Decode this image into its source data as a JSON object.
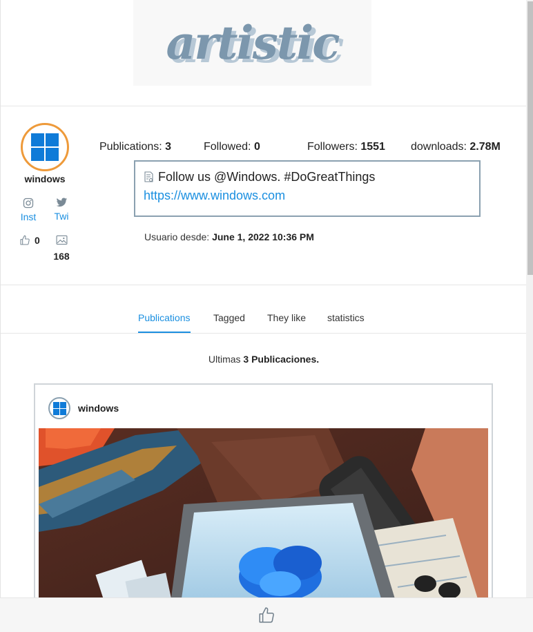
{
  "banner": {
    "logo_text": "artistic"
  },
  "profile": {
    "username": "windows",
    "social": [
      {
        "icon": "instagram-icon",
        "label": "Inst"
      },
      {
        "icon": "twitter-icon",
        "label": "Twi"
      }
    ],
    "likes": "0",
    "images": "168"
  },
  "stats": {
    "publications_label": "Publications:",
    "publications_value": "3",
    "followed_label": "Followed:",
    "followed_value": "0",
    "followers_label": "Followers:",
    "followers_value": "1551",
    "downloads_label": "downloads:",
    "downloads_value": "2.78M"
  },
  "bio": {
    "text": "Follow us @Windows. #DoGreatThings",
    "link": "https://www.windows.com"
  },
  "since": {
    "label": "Usuario desde:",
    "date": "June 1, 2022 10:36 PM"
  },
  "tabs": [
    {
      "label": "Publications",
      "active": true
    },
    {
      "label": "Tagged",
      "active": false
    },
    {
      "label": "They like",
      "active": false
    },
    {
      "label": "statistics",
      "active": false
    }
  ],
  "latest": {
    "prefix": "Ultimas",
    "count": "3",
    "suffix": "Publicaciones."
  },
  "post": {
    "username": "windows"
  },
  "colors": {
    "accent": "#1a8fe0",
    "avatar_ring": "#ee9a3a",
    "windows_blue": "#0f7bd8"
  }
}
